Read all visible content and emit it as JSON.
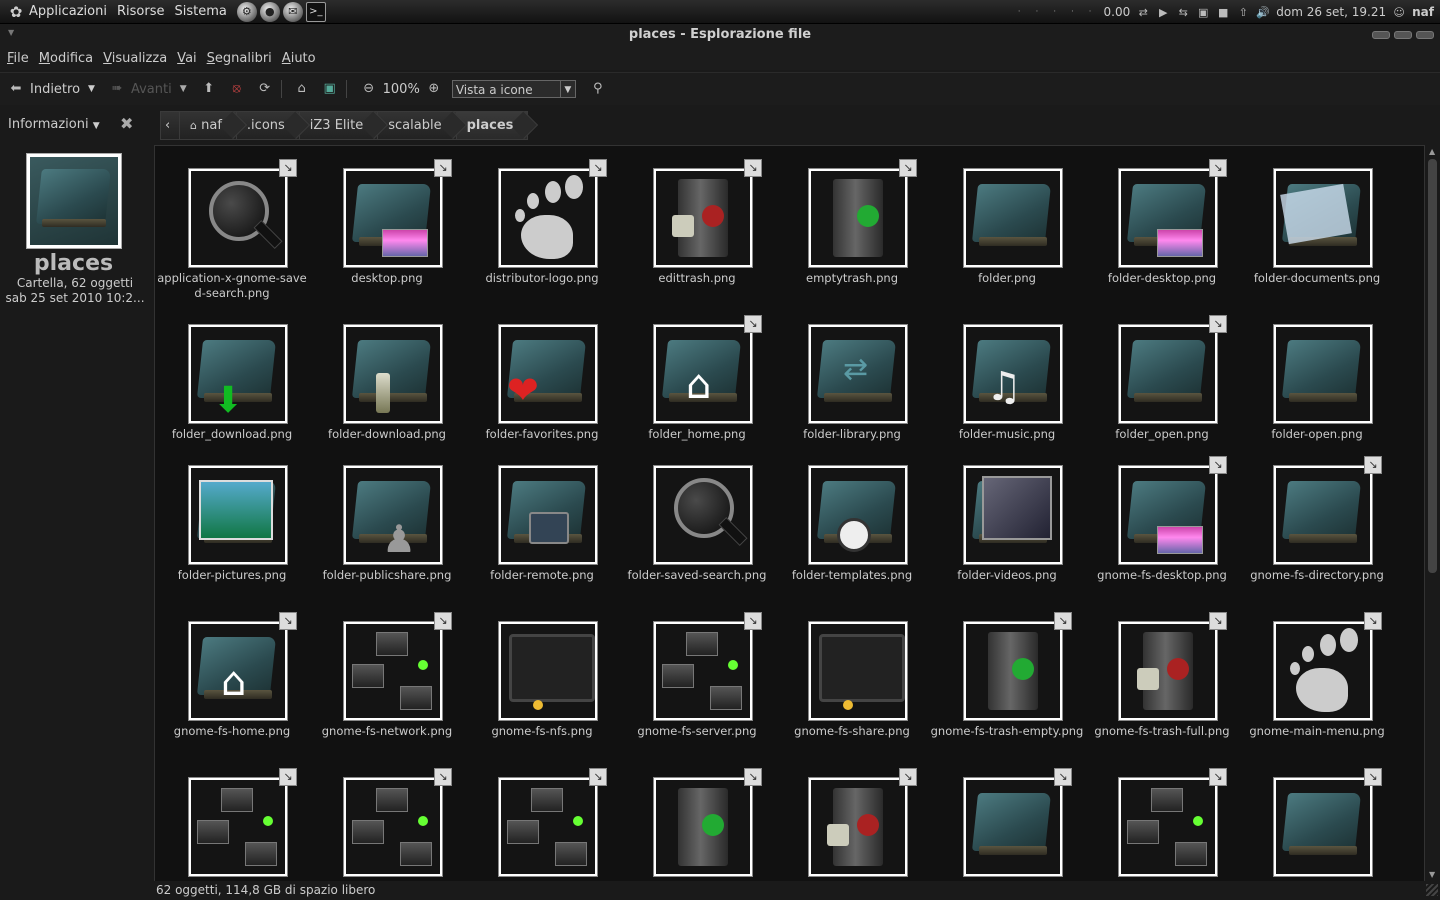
{
  "panel": {
    "menus": [
      "Applicazioni",
      "Risorse",
      "Sistema"
    ],
    "dots": "· · · · ·",
    "speed": "0.00",
    "datetime": "dom 26 set, 19.21",
    "user": "naf"
  },
  "window": {
    "title": "places - Esplorazione file"
  },
  "menubar": [
    "File",
    "Modifica",
    "Visualizza",
    "Vai",
    "Segnalibri",
    "Aiuto"
  ],
  "toolbar": {
    "back": "Indietro",
    "forward": "Avanti",
    "zoom": "100%",
    "view_mode": "Vista a icone"
  },
  "sidebar": {
    "mode": "Informazioni",
    "folder_name": "places",
    "folder_info": "Cartella, 62 oggetti",
    "modified": "sab 25 set 2010 10:2..."
  },
  "breadcrumbs": [
    "naf",
    ".icons",
    "iZ3 Elite",
    "scalable",
    "places"
  ],
  "files": [
    {
      "name": "application-x-gnome-saved-search.png",
      "icon": "search",
      "link": true
    },
    {
      "name": "desktop.png",
      "icon": "folder-desktop",
      "link": true
    },
    {
      "name": "distributor-logo.png",
      "icon": "gnome",
      "link": true
    },
    {
      "name": "edittrash.png",
      "icon": "trash-full",
      "link": true
    },
    {
      "name": "emptytrash.png",
      "icon": "trash-empty",
      "link": true
    },
    {
      "name": "folder.png",
      "icon": "folder",
      "link": false
    },
    {
      "name": "folder-desktop.png",
      "icon": "folder-desktop",
      "link": true
    },
    {
      "name": "folder-documents.png",
      "icon": "folder-documents",
      "link": false
    },
    {
      "name": "folder_download.png",
      "icon": "folder-download",
      "link": false
    },
    {
      "name": "folder-download.png",
      "icon": "folder-download2",
      "link": false
    },
    {
      "name": "folder-favorites.png",
      "icon": "folder-favorites",
      "link": false
    },
    {
      "name": "folder_home.png",
      "icon": "folder-home",
      "link": true
    },
    {
      "name": "folder-library.png",
      "icon": "folder-library",
      "link": false
    },
    {
      "name": "folder-music.png",
      "icon": "folder-music",
      "link": false
    },
    {
      "name": "folder_open.png",
      "icon": "folder",
      "link": true
    },
    {
      "name": "folder-open.png",
      "icon": "folder",
      "link": false
    },
    {
      "name": "folder-pictures.png",
      "icon": "folder-pictures",
      "link": false
    },
    {
      "name": "folder-publicshare.png",
      "icon": "folder-public",
      "link": false
    },
    {
      "name": "folder-remote.png",
      "icon": "folder-remote",
      "link": false
    },
    {
      "name": "folder-saved-search.png",
      "icon": "search",
      "link": false
    },
    {
      "name": "folder-templates.png",
      "icon": "folder-templates",
      "link": false
    },
    {
      "name": "folder-videos.png",
      "icon": "folder-videos",
      "link": false
    },
    {
      "name": "gnome-fs-desktop.png",
      "icon": "folder-desktop",
      "link": true
    },
    {
      "name": "gnome-fs-directory.png",
      "icon": "folder",
      "link": true
    },
    {
      "name": "gnome-fs-home.png",
      "icon": "folder-home",
      "link": true
    },
    {
      "name": "gnome-fs-network.png",
      "icon": "network",
      "link": true
    },
    {
      "name": "gnome-fs-nfs.png",
      "icon": "screen",
      "link": false
    },
    {
      "name": "gnome-fs-server.png",
      "icon": "network",
      "link": true
    },
    {
      "name": "gnome-fs-share.png",
      "icon": "screen",
      "link": false
    },
    {
      "name": "gnome-fs-trash-empty.png",
      "icon": "trash-empty",
      "link": true
    },
    {
      "name": "gnome-fs-trash-full.png",
      "icon": "trash-full",
      "link": true
    },
    {
      "name": "gnome-main-menu.png",
      "icon": "gnome",
      "link": true
    },
    {
      "name": "",
      "icon": "network",
      "link": true
    },
    {
      "name": "",
      "icon": "network",
      "link": true
    },
    {
      "name": "",
      "icon": "network",
      "link": true
    },
    {
      "name": "",
      "icon": "trash-empty",
      "link": true
    },
    {
      "name": "",
      "icon": "trash-full",
      "link": true
    },
    {
      "name": "",
      "icon": "folder",
      "link": true
    },
    {
      "name": "",
      "icon": "network",
      "link": true
    },
    {
      "name": "",
      "icon": "folder",
      "link": true
    }
  ],
  "statusbar": "62 oggetti, 114,8 GB di spazio libero",
  "colors": {
    "background": "#111111",
    "folder_teal": "#3f6a70",
    "accent_green": "#66ff33"
  }
}
